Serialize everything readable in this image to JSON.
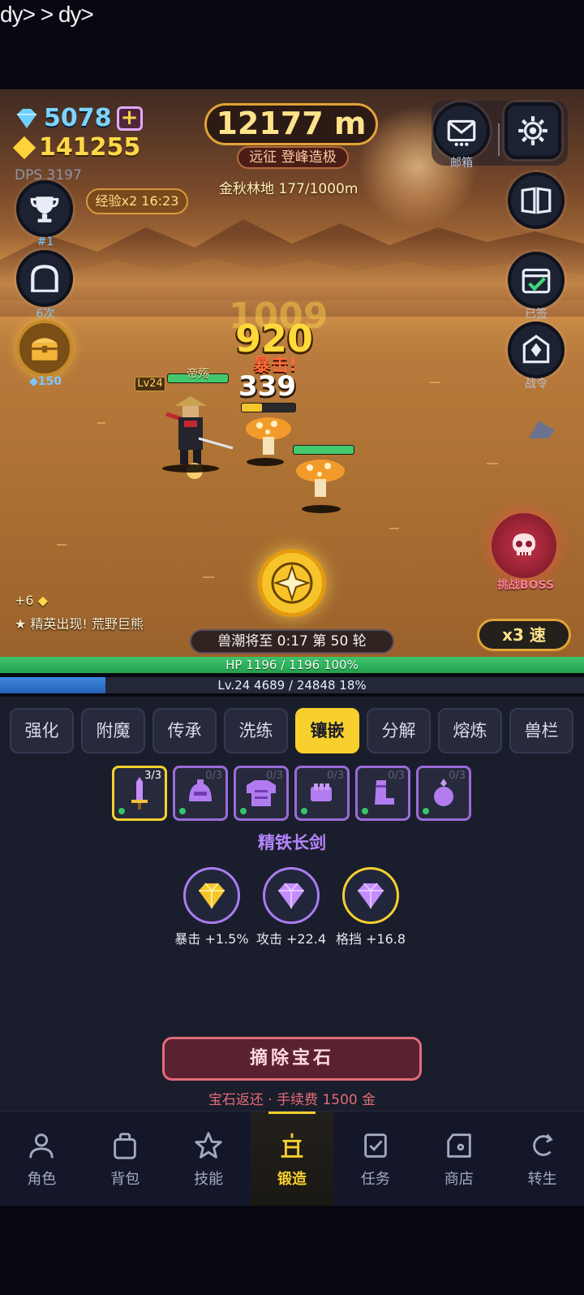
{
  "overlay_text": "dy> > dy>",
  "hud": {
    "gems": "5078",
    "plus": "+",
    "gold": "141255",
    "dps": "DPS 3197",
    "distance": "12177 m",
    "expedition": "远征 登峰造极",
    "region": "金秋林地  177/1000m",
    "exp_bonus": "经验x2 16:23",
    "mail_label": "邮箱"
  },
  "left_icons": [
    {
      "label": "#1",
      "icon": "trophy-icon"
    },
    {
      "label": "6次",
      "icon": "dungeon-gate-icon"
    },
    {
      "label": "150",
      "icon": "treasure-chest-icon"
    }
  ],
  "right_icons": [
    {
      "label": "",
      "icon": "book-icon"
    },
    {
      "label": "已签",
      "icon": "calendar-check-icon"
    },
    {
      "label": "战令",
      "icon": "battle-pass-icon"
    }
  ],
  "battle": {
    "hero_name": "帝殇",
    "hero_level": "Lv24",
    "damage_ghost": "1009",
    "damage_big": "920",
    "crit_label": "暴击!",
    "damage_white": "339",
    "gem_reward": "+6",
    "elite_notice": "★ 精英出现! 荒野巨熊",
    "wave": "兽潮将至 0:17   第 50 轮",
    "speed": "x3 速",
    "boss_label": "挑战BOSS"
  },
  "bars": {
    "hp_text": "HP  1196 / 1196  100%",
    "hp_fraction": 1.0,
    "exp_text": "Lv.24   4689 / 24848   18%",
    "exp_fraction": 0.18
  },
  "forge": {
    "tabs": [
      "强化",
      "附魔",
      "传承",
      "洗练",
      "镶嵌",
      "分解",
      "熔炼",
      "兽栏"
    ],
    "active_tab": "镶嵌",
    "slots": [
      {
        "count": "3/3",
        "icon": "sword-icon"
      },
      {
        "count": "0/3",
        "icon": "helmet-icon"
      },
      {
        "count": "0/3",
        "icon": "armor-icon"
      },
      {
        "count": "0/3",
        "icon": "gauntlet-icon"
      },
      {
        "count": "0/3",
        "icon": "boots-icon"
      },
      {
        "count": "0/3",
        "icon": "amulet-icon"
      }
    ],
    "item_name": "精铁长剑",
    "gems": [
      {
        "label": "暴击 +1.5%",
        "color": "#f5c62c"
      },
      {
        "label": "攻击 +22.4",
        "color": "#c48cff"
      },
      {
        "label": "格挡 +16.8",
        "color": "#c48cff"
      }
    ],
    "remove_button": "摘除宝石",
    "remove_note": "宝石返还 · 手续费 1500 金"
  },
  "nav": [
    {
      "label": "角色",
      "icon": "person-icon"
    },
    {
      "label": "背包",
      "icon": "bag-icon"
    },
    {
      "label": "技能",
      "icon": "star-icon"
    },
    {
      "label": "锻造",
      "icon": "anvil-icon"
    },
    {
      "label": "任务",
      "icon": "task-check-icon"
    },
    {
      "label": "商店",
      "icon": "shop-icon"
    },
    {
      "label": "转生",
      "icon": "rebirth-icon"
    }
  ],
  "nav_active": "锻造",
  "colors": {
    "accent": "#f7d02e",
    "gem_blue": "#7cd4ff",
    "gold": "#ffd84a",
    "hp_green": "#3ec46d",
    "exp_blue": "#3f88e0",
    "purple": "#b685ff",
    "danger": "#e36b78"
  }
}
